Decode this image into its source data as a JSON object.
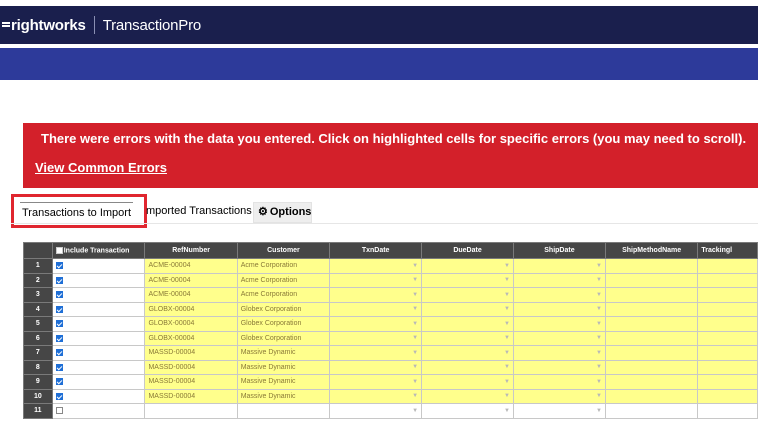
{
  "brand": {
    "company": "rightworks",
    "product": "TransactionPro"
  },
  "error": {
    "message": "There were errors with the data you entered. Click on highlighted cells for specific errors (you may need to scroll).",
    "link_label": "View Common Errors"
  },
  "tabs": {
    "active_label": "Transactions to Import",
    "imported_label": "mported Transactions",
    "options_label": "Options"
  },
  "grid": {
    "columns": [
      "Include Transaction",
      "RefNumber",
      "Customer",
      "TxnDate",
      "DueDate",
      "ShipDate",
      "ShipMethodName",
      "Trackingl"
    ],
    "rows": [
      {
        "num": "1",
        "checked": true,
        "ref": "ACME-00004",
        "customer": "Acme Corporation"
      },
      {
        "num": "2",
        "checked": true,
        "ref": "ACME-00004",
        "customer": "Acme Corporation"
      },
      {
        "num": "3",
        "checked": true,
        "ref": "ACME-00004",
        "customer": "Acme Corporation"
      },
      {
        "num": "4",
        "checked": true,
        "ref": "GLOBX-00004",
        "customer": "Globex Corporation"
      },
      {
        "num": "5",
        "checked": true,
        "ref": "GLOBX-00004",
        "customer": "Globex Corporation"
      },
      {
        "num": "6",
        "checked": true,
        "ref": "GLOBX-00004",
        "customer": "Globex Corporation"
      },
      {
        "num": "7",
        "checked": true,
        "ref": "MASSD-00004",
        "customer": "Massive Dynamic"
      },
      {
        "num": "8",
        "checked": true,
        "ref": "MASSD-00004",
        "customer": "Massive Dynamic"
      },
      {
        "num": "9",
        "checked": true,
        "ref": "MASSD-00004",
        "customer": "Massive Dynamic"
      },
      {
        "num": "10",
        "checked": true,
        "ref": "MASSD-00004",
        "customer": "Massive Dynamic"
      },
      {
        "num": "11",
        "checked": false,
        "ref": "",
        "customer": ""
      }
    ]
  },
  "colors": {
    "navbar": "#1a1f4d",
    "bluebar": "#2d3a9a",
    "error": "#d3202a",
    "highlight": "#ffff8c",
    "grid_header": "#464646"
  },
  "icons": {
    "options": "gear-icon",
    "dropdown": "chevron-down-icon"
  }
}
